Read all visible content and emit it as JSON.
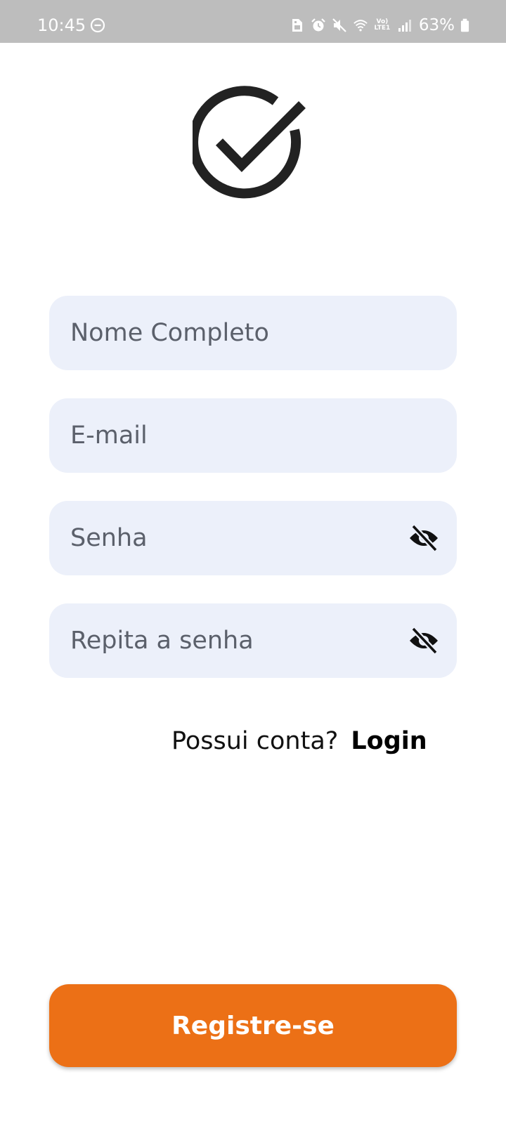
{
  "status_bar": {
    "time": "10:45",
    "network_label": "Vo) LTE1",
    "battery": "63%",
    "icons": [
      "do-not-disturb-icon",
      "sim-card-icon",
      "alarm-icon",
      "mute-icon",
      "wifi-icon",
      "lte-icon",
      "signal-icon",
      "battery-icon"
    ]
  },
  "logo": {
    "icon": "check-circle-icon",
    "color": "#222222"
  },
  "form": {
    "full_name": {
      "placeholder": "Nome Completo",
      "value": ""
    },
    "email": {
      "placeholder": "E-mail",
      "value": ""
    },
    "password": {
      "placeholder": "Senha",
      "value": "",
      "toggle_icon": "eye-off-icon"
    },
    "repeat_password": {
      "placeholder": "Repita a senha",
      "value": "",
      "toggle_icon": "eye-off-icon"
    }
  },
  "login_prompt": {
    "text": "Possui conta?",
    "link": "Login"
  },
  "register_button": {
    "label": "Registre-se",
    "color": "#ec7016"
  },
  "colors": {
    "field_background": "#ecf0fa",
    "status_bar": "#bdbdbd"
  }
}
